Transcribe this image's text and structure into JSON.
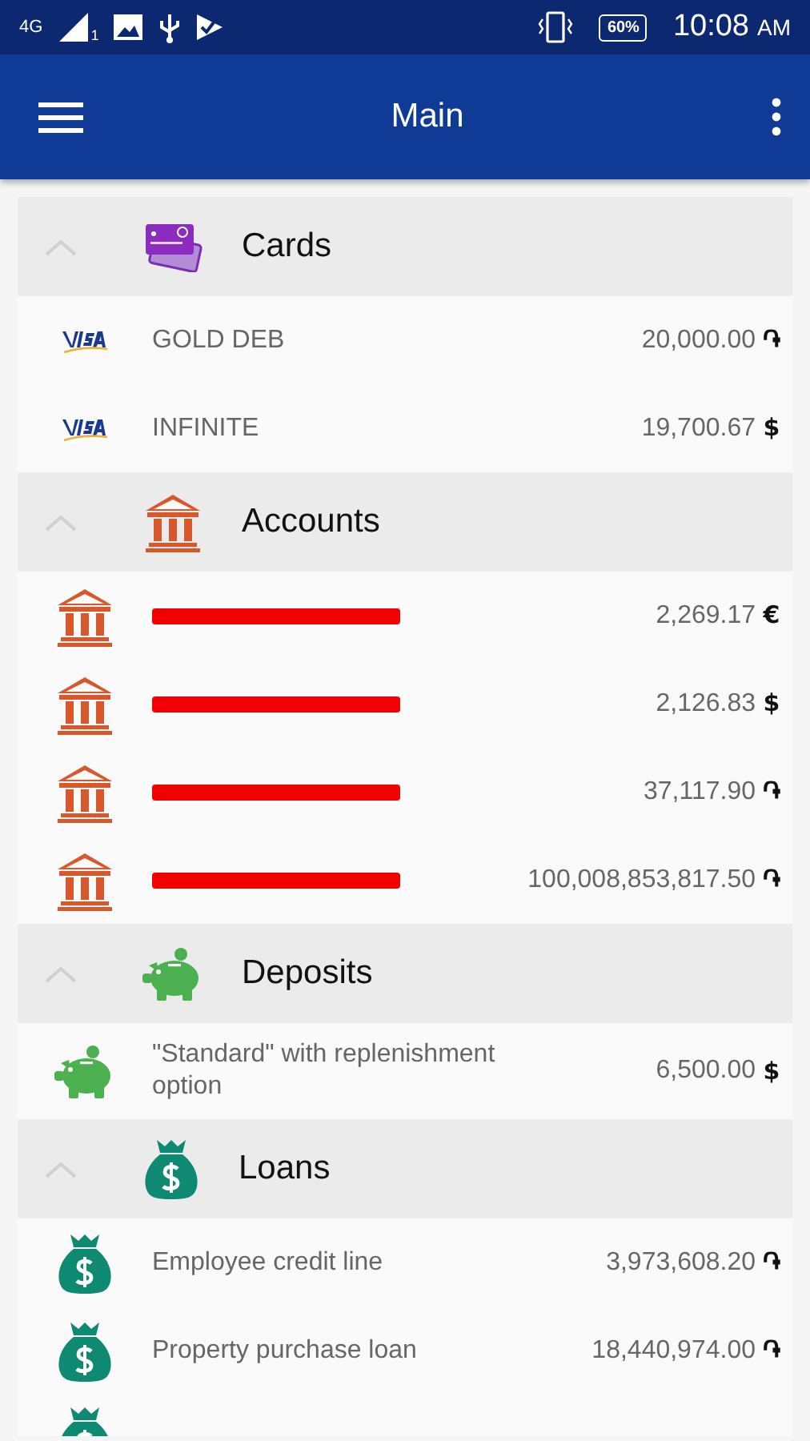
{
  "status_bar": {
    "network": "4G",
    "sim": "1",
    "battery": "60%",
    "time": "10:08",
    "ampm": "AM"
  },
  "app_bar": {
    "title": "Main"
  },
  "sections": [
    {
      "title": "Cards",
      "kind": "cards",
      "expanded": true,
      "items": [
        {
          "kind": "visa",
          "name": "GOLD DEB",
          "amount": "20,000.00",
          "currency": "֏"
        },
        {
          "kind": "visa",
          "name": "INFINITE",
          "amount": "19,700.67",
          "currency": "$"
        }
      ]
    },
    {
      "title": "Accounts",
      "kind": "bank",
      "expanded": true,
      "items": [
        {
          "kind": "bank",
          "redacted": true,
          "amount": "2,269.17",
          "currency": "€"
        },
        {
          "kind": "bank",
          "redacted": true,
          "amount": "2,126.83",
          "currency": "$"
        },
        {
          "kind": "bank",
          "redacted": true,
          "amount": "37,117.90",
          "currency": "֏"
        },
        {
          "kind": "bank",
          "redacted": true,
          "amount": "100,008,853,817.50",
          "currency": "֏"
        }
      ]
    },
    {
      "title": "Deposits",
      "kind": "piggy",
      "expanded": true,
      "items": [
        {
          "kind": "piggy",
          "name": "\"Standard\" with replenishment option",
          "amount": "6,500.00",
          "currency": "$"
        }
      ]
    },
    {
      "title": "Loans",
      "kind": "moneybag",
      "expanded": true,
      "items": [
        {
          "kind": "moneybag",
          "name": "Employee credit line",
          "amount": "3,973,608.20",
          "currency": "֏"
        },
        {
          "kind": "moneybag",
          "name": "Property purchase loan",
          "amount": "18,440,974.00",
          "currency": "֏"
        },
        {
          "kind": "moneybag"
        }
      ]
    }
  ]
}
